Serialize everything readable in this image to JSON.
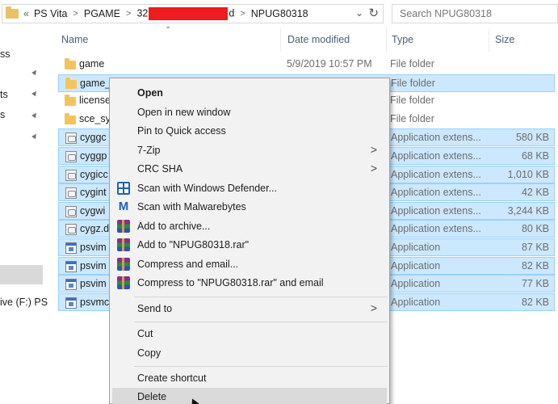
{
  "address": {
    "crumbs": [
      "«",
      "PS Vita",
      "PGAME",
      "32",
      "d",
      "NPUG80318"
    ],
    "search_placeholder": "Search NPUG80318"
  },
  "nav": {
    "items": [
      "ss",
      "ts",
      "s",
      "ive (F:) PS"
    ]
  },
  "columns": {
    "name": "Name",
    "date": "Date modified",
    "type": "Type",
    "size": "Size"
  },
  "rows": [
    {
      "name": "game",
      "date": "5/9/2019 10:57 PM",
      "type": "File folder",
      "size": "",
      "icon": "folder-icon",
      "selected": false
    },
    {
      "name": "game_",
      "date": "",
      "type": "File folder",
      "size": "",
      "icon": "folder-icon",
      "selected": true
    },
    {
      "name": "license",
      "date": "",
      "type": "File folder",
      "size": "",
      "icon": "folder-icon",
      "selected": false
    },
    {
      "name": "sce_sy",
      "date": "",
      "type": "File folder",
      "size": "",
      "icon": "folder-icon",
      "selected": false
    },
    {
      "name": "cyggc",
      "date": "",
      "type": "Application extens...",
      "size": "580 KB",
      "icon": "dll-icon",
      "selected": true
    },
    {
      "name": "cyggp",
      "date": "",
      "type": "Application extens...",
      "size": "68 KB",
      "icon": "dll-icon",
      "selected": true
    },
    {
      "name": "cygicc",
      "date": "",
      "type": "Application extens...",
      "size": "1,010 KB",
      "icon": "dll-icon",
      "selected": true
    },
    {
      "name": "cygint",
      "date": "",
      "type": "Application extens...",
      "size": "42 KB",
      "icon": "dll-icon",
      "selected": true
    },
    {
      "name": "cygwi",
      "date": "",
      "type": "Application extens...",
      "size": "3,244 KB",
      "icon": "dll-icon",
      "selected": true
    },
    {
      "name": "cygz.d",
      "date": "",
      "type": "Application extens...",
      "size": "80 KB",
      "icon": "dll-icon",
      "selected": true
    },
    {
      "name": "psvim",
      "date": "",
      "type": "Application",
      "size": "87 KB",
      "icon": "exe-icon",
      "selected": true
    },
    {
      "name": "psvim",
      "date": "",
      "type": "Application",
      "size": "82 KB",
      "icon": "exe-icon",
      "selected": true
    },
    {
      "name": "psvim",
      "date": "",
      "type": "Application",
      "size": "77 KB",
      "icon": "exe-icon",
      "selected": true
    },
    {
      "name": "psvmc",
      "date": "",
      "type": "Application",
      "size": "82 KB",
      "icon": "exe-icon",
      "selected": true
    }
  ],
  "context_menu": {
    "open": "Open",
    "open_new_window": "Open in new window",
    "pin_quick_access": "Pin to Quick access",
    "seven_zip": "7-Zip",
    "crc_sha": "CRC SHA",
    "scan_defender": "Scan with Windows Defender...",
    "scan_malwarebytes": "Scan with Malwarebytes",
    "add_archive": "Add to archive...",
    "add_rar": "Add to \"NPUG80318.rar\"",
    "compress_email": "Compress and email...",
    "compress_rar_email": "Compress to \"NPUG80318.rar\" and email",
    "send_to": "Send to",
    "cut": "Cut",
    "copy": "Copy",
    "create_shortcut": "Create shortcut",
    "delete": "Delete"
  },
  "colors": {
    "selection_bg": "#cce8ff",
    "selection_border": "#99d1ff",
    "menu_bg": "#f2f2f2",
    "redaction": "#ee1c1c"
  }
}
